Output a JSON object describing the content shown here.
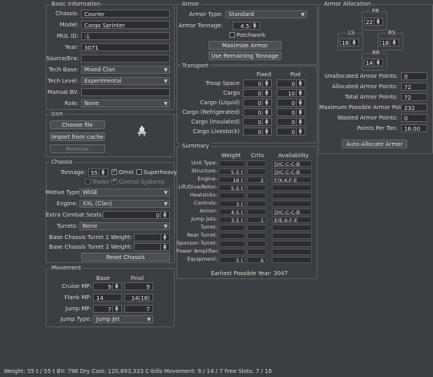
{
  "basic": {
    "title": "Basic Information",
    "chassis_label": "Chassis:",
    "chassis": "Courier",
    "model_label": "Model:",
    "model": "Cargo Sprinter",
    "mulid_label": "MUL ID:",
    "mulid": "-1",
    "year_label": "Year:",
    "year": "3071",
    "source_label": "Source/Era:",
    "source": "",
    "techbase_label": "Tech Base:",
    "techbase": "Mixed Clan",
    "techlevel_label": "Tech Level:",
    "techlevel": "Experimental",
    "manualbv_label": "Manual BV:",
    "manualbv": "",
    "role_label": "Role:",
    "role": "None"
  },
  "icon": {
    "title": "Icon",
    "choose": "Choose file",
    "import": "Import from cache",
    "remove": "Remove"
  },
  "chassis": {
    "title": "Chassis",
    "tonnage_label": "Tonnage:",
    "tonnage": "55",
    "omni": "Omni",
    "superheavy": "Superheavy",
    "trailer": "Trailer",
    "control": "Control Systems",
    "motive_label": "Motive Type:",
    "motive": "WiGE",
    "engine_label": "Engine:",
    "engine": "XXL (Clan)",
    "seats_label": "Extra Combat Seats:",
    "seats": "0",
    "turrets_label": "Turrets:",
    "turrets": "None",
    "t1_label": "Base Chassis Turret 1 Weight:",
    "t1": "",
    "t2_label": "Base Chassis Turret 2 Weight:",
    "t2": "",
    "reset": "Reset Chassis"
  },
  "movement": {
    "title": "Movement",
    "base_hdr": "Base",
    "final_hdr": "Final",
    "cruise_label": "Cruise MP:",
    "cruise_base": "9",
    "cruise_final": "9",
    "flank_label": "Flank MP:",
    "flank_base": "14",
    "flank_final": "14(18)",
    "jump_label": "Jump MP:",
    "jump_base": "7",
    "jump_final": "7",
    "jumptype_label": "Jump Type:",
    "jumptype": "Jump Jet"
  },
  "armor": {
    "title": "Armor",
    "type_label": "Armor Type:",
    "type": "Standard",
    "tonnage_label": "Armor Tonnage:",
    "tonnage": "4.5",
    "patchwork": "Patchwork",
    "maximize": "Maximize Armor",
    "use_remaining": "Use Remaining Tonnage"
  },
  "transport": {
    "title": "Transport",
    "fixed_hdr": "Fixed",
    "pod_hdr": "Pod",
    "rows": [
      {
        "label": "Troop Space",
        "fixed": "0",
        "pod": "0"
      },
      {
        "label": "Cargo",
        "fixed": "0",
        "pod": "10"
      },
      {
        "label": "Cargo (Liquid)",
        "fixed": "0",
        "pod": "0"
      },
      {
        "label": "Cargo (Refrigerated)",
        "fixed": "0",
        "pod": "0"
      },
      {
        "label": "Cargo (Insulated)",
        "fixed": "0",
        "pod": "0"
      },
      {
        "label": "Cargo Livestock)",
        "fixed": "0",
        "pod": "0"
      }
    ]
  },
  "summary": {
    "title": "Summary",
    "weight_hdr": "Weight",
    "crits_hdr": "Crits",
    "avail_hdr": "Availability",
    "rows": [
      {
        "label": "Unit Type:",
        "weight": "",
        "crits": "",
        "avail": "D/C-C-C-B"
      },
      {
        "label": "Structure:",
        "weight": "5.5 t",
        "crits": "",
        "avail": "D/C-C-C-B"
      },
      {
        "label": "Engine:",
        "weight": "16 t",
        "crits": "2",
        "avail": "F/X-X-F-E"
      },
      {
        "label": "Lift/Dive/Rotor:",
        "weight": "5.5 t",
        "crits": "",
        "avail": ""
      },
      {
        "label": "Heatsinks:",
        "weight": "",
        "crits": "",
        "avail": ""
      },
      {
        "label": "Controls:",
        "weight": "3 t",
        "crits": "",
        "avail": ""
      },
      {
        "label": "Armor:",
        "weight": "4.5 t",
        "crits": "",
        "avail": "D/C-C-C-B"
      },
      {
        "label": "Jump Jets:",
        "weight": "3.5 t",
        "crits": "1",
        "avail": "E/E-X-F-E"
      },
      {
        "label": "Turret:",
        "weight": "",
        "crits": "",
        "avail": ""
      },
      {
        "label": "Rear Turret:",
        "weight": "",
        "crits": "",
        "avail": ""
      },
      {
        "label": "Sponson Turret:",
        "weight": "",
        "crits": "",
        "avail": ""
      },
      {
        "label": "Power Amplifier:",
        "weight": "",
        "crits": "",
        "avail": ""
      },
      {
        "label": "Equipment:",
        "weight": "5 t",
        "crits": "6",
        "avail": ""
      }
    ],
    "earliest": "Earliest Possible Year: 3047"
  },
  "allocation": {
    "title": "Armor Allocation",
    "fr_label": "FR",
    "fr": "22",
    "ls_label": "LS",
    "ls": "18",
    "rs_label": "RS",
    "rs": "18",
    "rr_label": "RR",
    "rr": "14",
    "unalloc_label": "Unallocated Armor Points:",
    "unalloc": "0",
    "alloc_label": "Allocated Armor Points:",
    "alloc": "72",
    "total_label": "Total Armor Points:",
    "total": "72",
    "max_label": "Maximum Possible Armor Points:",
    "max": "232",
    "wasted_label": "Wasted Armor Points:",
    "wasted": "0",
    "ppt_label": "Points Per Ton:",
    "ppt": "16.00",
    "auto": "Auto-Allocate Armor"
  },
  "status": "Weight: 55 t / 55 t    BV: 796    Dry Cost: 120,693,333 C-bills    Movement: 9 / 14 / 7    Free Slots: 7 / 16"
}
